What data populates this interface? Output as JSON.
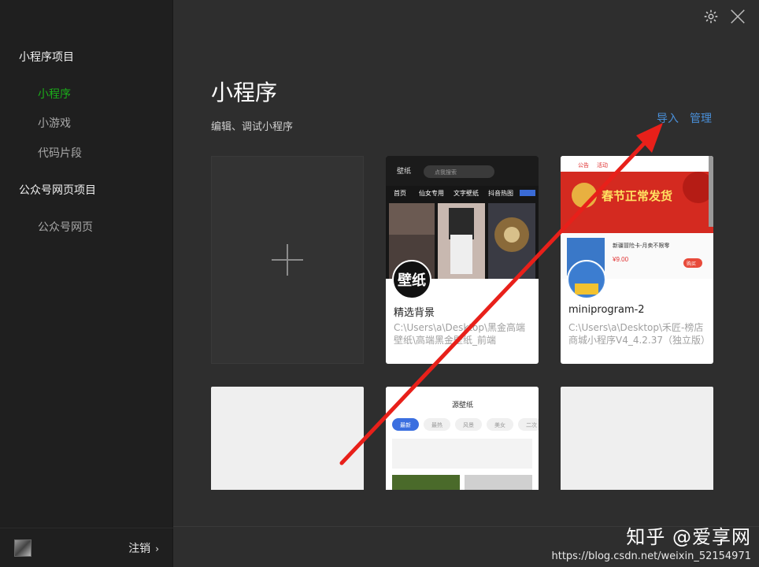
{
  "sidebar": {
    "section1": "小程序项目",
    "items1": [
      "小程序",
      "小游戏",
      "代码片段"
    ],
    "section2": "公众号网页项目",
    "items2": [
      "公众号网页"
    ],
    "logout": "注销",
    "logout_chevron": "›"
  },
  "main": {
    "title": "小程序",
    "subtitle": "编辑、调试小程序",
    "import_label": "导入",
    "manage_label": "管理",
    "projects": [
      {
        "name": "精选背景",
        "path": "C:\\Users\\a\\Desktop\\黑金高端壁纸\\高端黑金壁纸_前端",
        "icon_text": "壁纸"
      },
      {
        "name": "miniprogram-2",
        "path": "C:\\Users\\a\\Desktop\\禾匠-榜店商城小程序V4_4.2.37（独立版）"
      }
    ],
    "thumb1": {
      "logo": "壁纸",
      "search_placeholder": "点我搜索",
      "tabs": [
        "首页",
        "仙女专用",
        "文字壁纸",
        "抖音热图"
      ]
    },
    "thumb2": {
      "tabs": [
        "公告",
        "活动"
      ],
      "banner": "春节正常发货",
      "product_title": "新疆冒险卡-月卖不限零",
      "price": "¥9.00",
      "buy": "购买"
    },
    "thumb3": {
      "title": "源壁纸",
      "tabs": [
        "最新",
        "最热",
        "风景",
        "美女",
        "二次"
      ]
    }
  },
  "watermark": {
    "brand": "知乎 @爱享网",
    "url": "https://blog.csdn.net/weixin_52154971"
  },
  "colors": {
    "sidebar_bg": "#1f1f1f",
    "main_bg": "#2e2e2e",
    "active_green": "#1aad19",
    "link_blue": "#4a90d9",
    "arrow_red": "#e8201a"
  }
}
